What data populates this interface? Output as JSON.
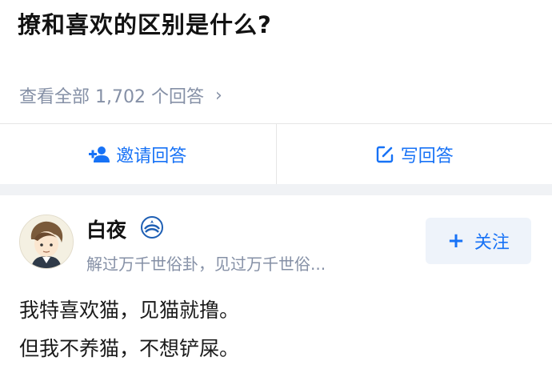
{
  "question": {
    "title": "撩和喜欢的区别是什么?",
    "view_all": "查看全部 1,702 个回答",
    "chevron": "›"
  },
  "actions": {
    "invite": "邀请回答",
    "write": "写回答"
  },
  "answer": {
    "author_name": "白夜",
    "author_bio": "解过万千世俗卦，见过万千世俗...",
    "follow_label": "关注",
    "lines": [
      "我特喜欢猫，见猫就撸。",
      "但我不养猫，不想铲屎。"
    ]
  },
  "colors": {
    "accent": "#1772f6",
    "muted": "#8590a6",
    "band": "#f0f2f5",
    "follow_bg": "#eef3fa"
  },
  "icons": {
    "invite": "add-person-icon",
    "write": "edit-icon",
    "badge": "verified-badge-icon",
    "chevron": "chevron-right-icon"
  }
}
